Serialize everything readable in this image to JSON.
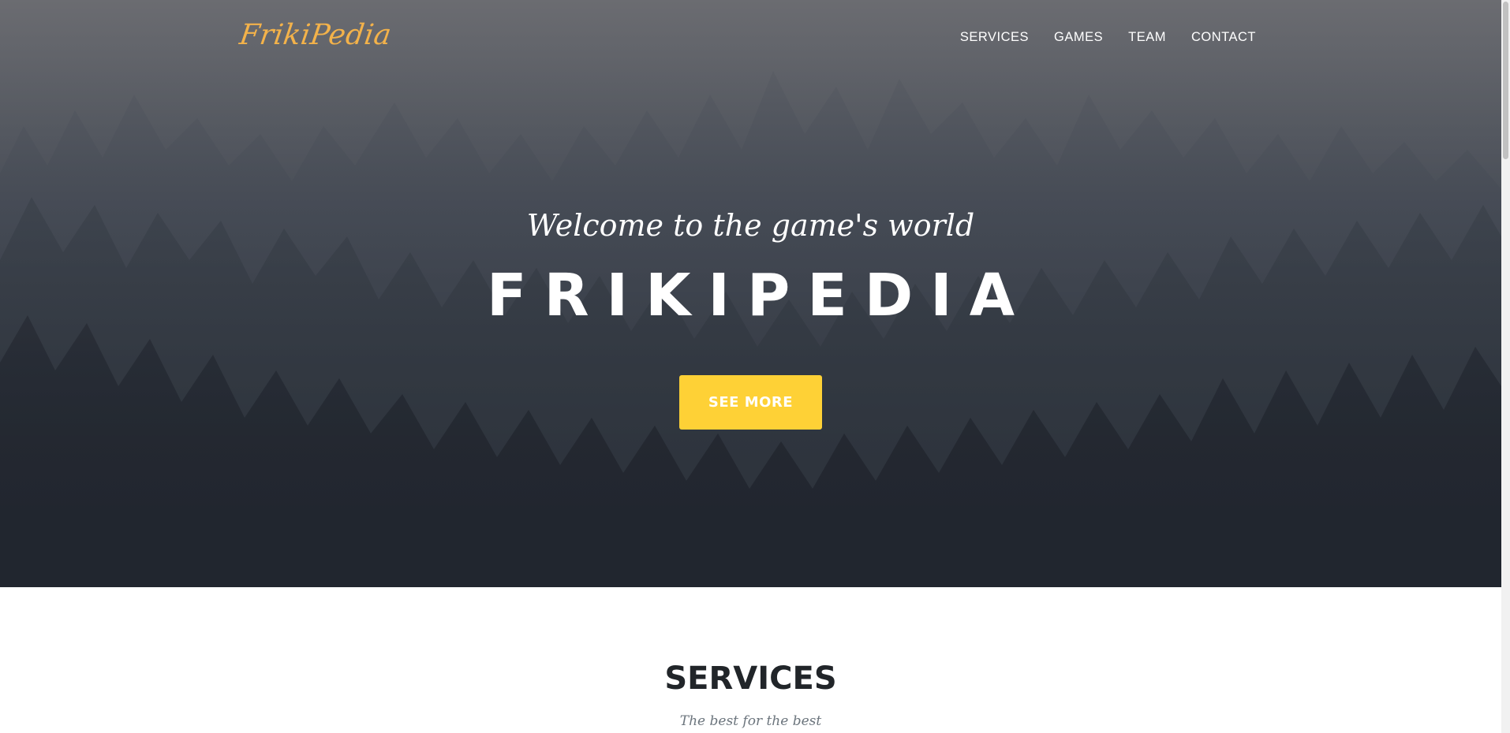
{
  "brand": {
    "logo": "FrikiPedia",
    "accent": "#fed136",
    "logo_color": "#f3b24a"
  },
  "nav": {
    "items": [
      {
        "label": "SERVICES"
      },
      {
        "label": "GAMES"
      },
      {
        "label": "TEAM"
      },
      {
        "label": "CONTACT"
      }
    ]
  },
  "hero": {
    "subtitle": "Welcome to the game's world",
    "title": "FRIKIPEDIA",
    "button_label": "SEE MORE"
  },
  "services": {
    "title": "SERVICES",
    "subtitle": "The best for the best"
  }
}
